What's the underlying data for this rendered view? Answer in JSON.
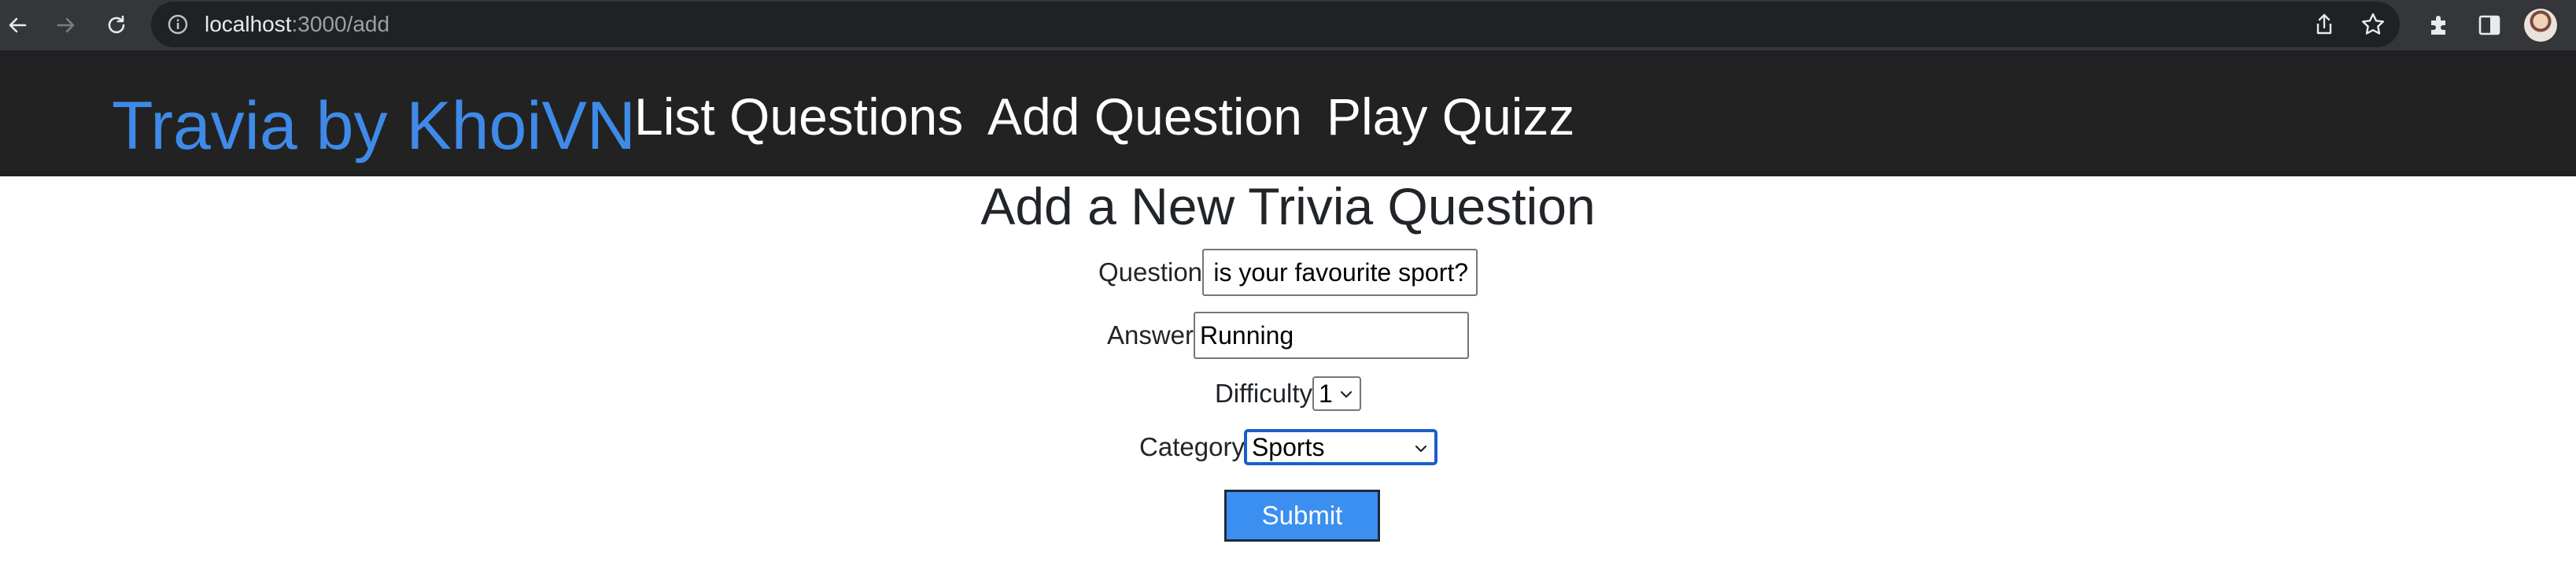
{
  "browser": {
    "url_host": "localhost",
    "url_path": ":3000/add",
    "icons": {
      "back": "arrow-left-icon",
      "forward": "arrow-right-icon",
      "reload": "reload-icon",
      "site_info": "info-circle-icon",
      "share": "share-icon",
      "bookmark": "star-icon",
      "extensions": "puzzle-icon",
      "side_panel": "side-panel-icon",
      "profile": "avatar"
    }
  },
  "header": {
    "brand": "Travia by KhoiVN",
    "nav": [
      {
        "label": "List Questions"
      },
      {
        "label": "Add Question"
      },
      {
        "label": "Play Quizz"
      }
    ],
    "brand_color": "#3f8ae8",
    "background_color": "#222222"
  },
  "form": {
    "title": "Add a New Trivia Question",
    "question": {
      "label": "Question",
      "value": "is your favourite sport?"
    },
    "answer": {
      "label": "Answer",
      "value": "Running"
    },
    "difficulty": {
      "label": "Difficulty",
      "selected": "1"
    },
    "category": {
      "label": "Category",
      "selected": "Sports"
    },
    "submit_label": "Submit",
    "submit_color": "#3b8ff0"
  }
}
